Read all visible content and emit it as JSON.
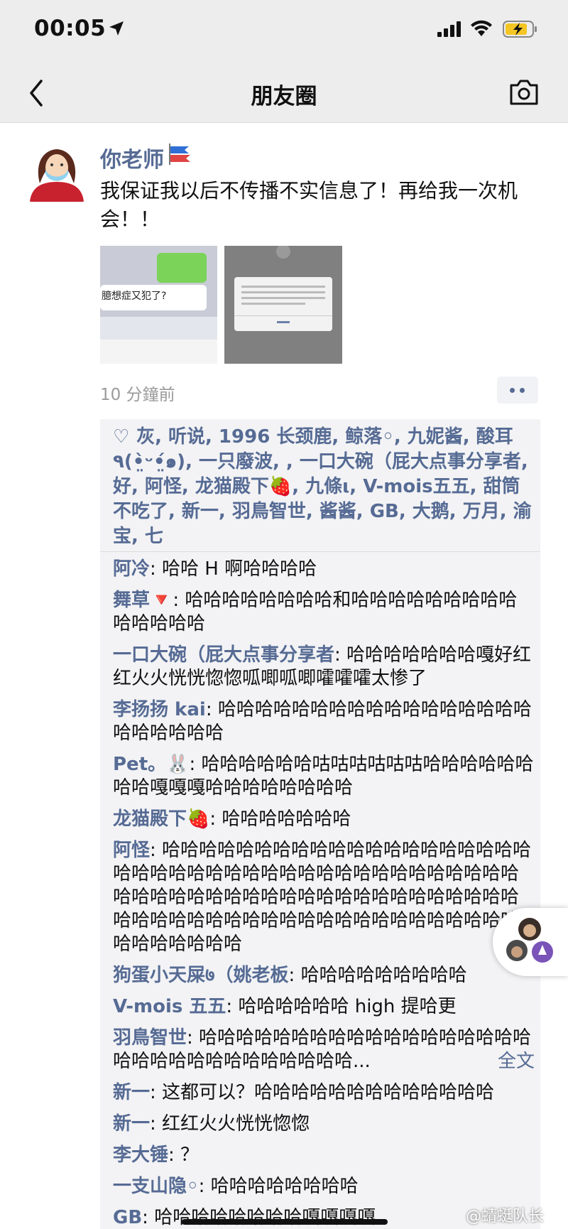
{
  "status_bar": {
    "time": "00:05"
  },
  "nav": {
    "title": "朋友圈"
  },
  "post": {
    "author": "你老师",
    "text": "我保证我以后不传播不实信息了！再给我一次机会！！",
    "image1_caption": "臆想症又犯了?",
    "time": "10 分鐘前"
  },
  "likes": {
    "text": "灰, 听说, 1996 长颈鹿, 鲸落◦, 九妮酱, 酸耳٩(•̤̀ᵕ•̤́๑), 一只廢波, , 一口大碗（屁大点事分享者, 好, 阿怪, 龙猫殿下🍓, 九條ι, V-mois五五, 甜筒不吃了, 新一, 羽鳥智世, 酱酱, GB, 大鹅, 万月, 渝宝, 七"
  },
  "comments": [
    {
      "name": "阿冷",
      "text": "哈哈 H 啊哈哈哈哈"
    },
    {
      "name": "舞草🔻",
      "text": "哈哈哈哈哈哈哈哈和哈哈哈哈哈哈哈哈哈哈哈哈哈哈"
    },
    {
      "name": "一口大碗（屁大点事分享者",
      "text": "哈哈哈哈哈哈哈嘎好红红火火恍恍惚惚呱唧呱唧嚯嚯嚯太惨了"
    },
    {
      "name": "李扬扬 kai",
      "text": "哈哈哈哈哈哈哈哈哈哈哈哈哈哈哈哈哈哈哈哈哈哈哈"
    },
    {
      "name": "Pet。🐰",
      "text": "哈哈哈哈哈哈咕咕咕咕咕咕哈哈哈哈哈哈哈哈嘎嘎嘎哈哈哈哈哈哈哈哈"
    },
    {
      "name": "龙猫殿下🍓",
      "text": "哈哈哈哈哈哈哈"
    },
    {
      "name": "阿怪",
      "text": "哈哈哈哈哈哈哈哈哈哈哈哈哈哈哈哈哈哈哈哈哈哈哈哈哈哈哈哈哈哈哈哈哈哈哈哈哈哈哈哈哈哈哈哈哈哈哈哈哈哈哈哈哈哈哈哈哈哈哈哈哈哈哈哈哈哈哈哈哈哈哈哈哈哈哈哈哈哈哈哈哈哈哈哈哈哈哈哈哈哈哈哈哈"
    },
    {
      "name": "狗蛋小天屎७（姚老板",
      "text": "哈哈哈哈哈哈哈哈哈"
    },
    {
      "name": "V-mois 五五",
      "text": "哈哈哈哈哈哈 high 提哈更"
    },
    {
      "name": "羽鳥智世",
      "text": "哈哈哈哈哈哈哈哈哈哈哈哈哈哈哈哈哈哈哈哈哈哈哈哈哈哈哈哈哈哈哈...",
      "more": "全文"
    },
    {
      "name": "新一",
      "text": "这都可以？哈哈哈哈哈哈哈哈哈哈哈哈哈"
    },
    {
      "name": "新一",
      "text": "红红火火恍恍惚惚"
    },
    {
      "name": "李大锤",
      "text": "？"
    },
    {
      "name": "一支山隐◦",
      "text": "哈哈哈哈哈哈哈哈"
    },
    {
      "name": "GB",
      "text": "哈哈哈哈哈哈哈哈嘎嘎嘎嘎"
    }
  ],
  "watermark": "@蜻蜓队长",
  "colors": {
    "link": "#566b94",
    "nav_bg": "#ededed",
    "box_bg": "#f3f3f5"
  }
}
